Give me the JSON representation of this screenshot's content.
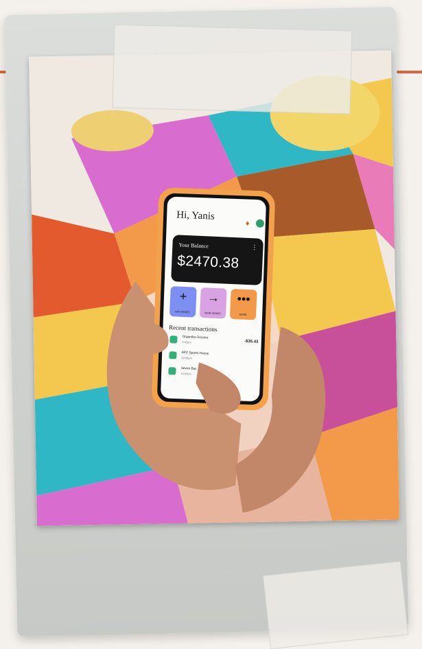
{
  "screen": {
    "greeting": "Hi, Yanis",
    "balance_label": "Your Balance",
    "balance_value": "$2470.38",
    "actions": [
      {
        "label": "ADD MONEY",
        "icon": "plus-icon",
        "glyph": "+",
        "color": "#7d8ff0"
      },
      {
        "label": "SEND MONEY",
        "icon": "arrow-right-icon",
        "glyph": "→",
        "color": "#d9a3e3"
      },
      {
        "label": "MORE",
        "icon": "more-icon",
        "glyph": "•••",
        "color": "#f29a4a"
      }
    ],
    "recent_title": "Recent transactions",
    "transactions": [
      {
        "name": "Organika Grocers",
        "time": "2:42pm",
        "amount": "-$35.43"
      },
      {
        "name": "APZ Sports House",
        "time": "10:45pm",
        "amount": ""
      },
      {
        "name": "Seven Bar",
        "time": "10:05pm",
        "amount": ""
      }
    ]
  },
  "colors": {
    "accent_orange": "#d9673a",
    "phone_case": "#f4a14c",
    "positive_green": "#35b07a"
  }
}
